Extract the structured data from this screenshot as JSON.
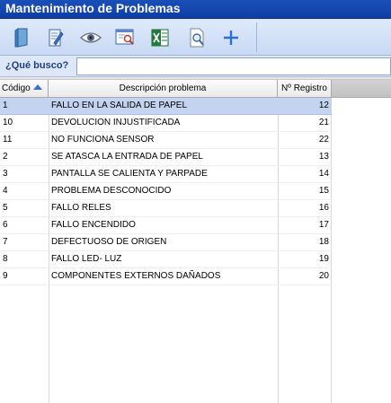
{
  "window": {
    "title": "Mantenimiento de Problemas"
  },
  "toolbar": {
    "buttons": [
      {
        "icon": "new-document-icon"
      },
      {
        "icon": "edit-document-icon"
      },
      {
        "icon": "view-eye-icon"
      },
      {
        "icon": "preview-icon"
      },
      {
        "icon": "excel-export-icon"
      },
      {
        "icon": "search-document-icon"
      },
      {
        "icon": "add-plus-icon"
      }
    ]
  },
  "search": {
    "label": "¿Qué busco?",
    "value": "",
    "placeholder": ""
  },
  "table": {
    "columns": [
      "Código",
      "Descripción problema",
      "Nº Registro"
    ],
    "rows": [
      {
        "code": "1",
        "description": "FALLO EN LA SALIDA DE PAPEL",
        "registro": "12"
      },
      {
        "code": "10",
        "description": "DEVOLUCION INJUSTIFICADA",
        "registro": "21"
      },
      {
        "code": "11",
        "description": "NO FUNCIONA SENSOR",
        "registro": "22"
      },
      {
        "code": "2",
        "description": "SE ATASCA LA ENTRADA DE PAPEL",
        "registro": "13"
      },
      {
        "code": "3",
        "description": "PANTALLA SE CALIENTA Y PARPADE",
        "registro": "14"
      },
      {
        "code": "4",
        "description": "PROBLEMA DESCONOCIDO",
        "registro": "15"
      },
      {
        "code": "5",
        "description": "FALLO RELES",
        "registro": "16"
      },
      {
        "code": "6",
        "description": "FALLO ENCENDIDO",
        "registro": "17"
      },
      {
        "code": "7",
        "description": "DEFECTUOSO DE ORIGEN",
        "registro": "18"
      },
      {
        "code": "8",
        "description": "FALLO LED- LUZ",
        "registro": "19"
      },
      {
        "code": "9",
        "description": "COMPONENTES EXTERNOS DAÑADOS",
        "registro": "20"
      }
    ],
    "selected_index": 0
  },
  "colors": {
    "titlebar": "#1a4fb8",
    "selection": "#c3d3f0",
    "sort_arrow": "#3a6fd0"
  }
}
